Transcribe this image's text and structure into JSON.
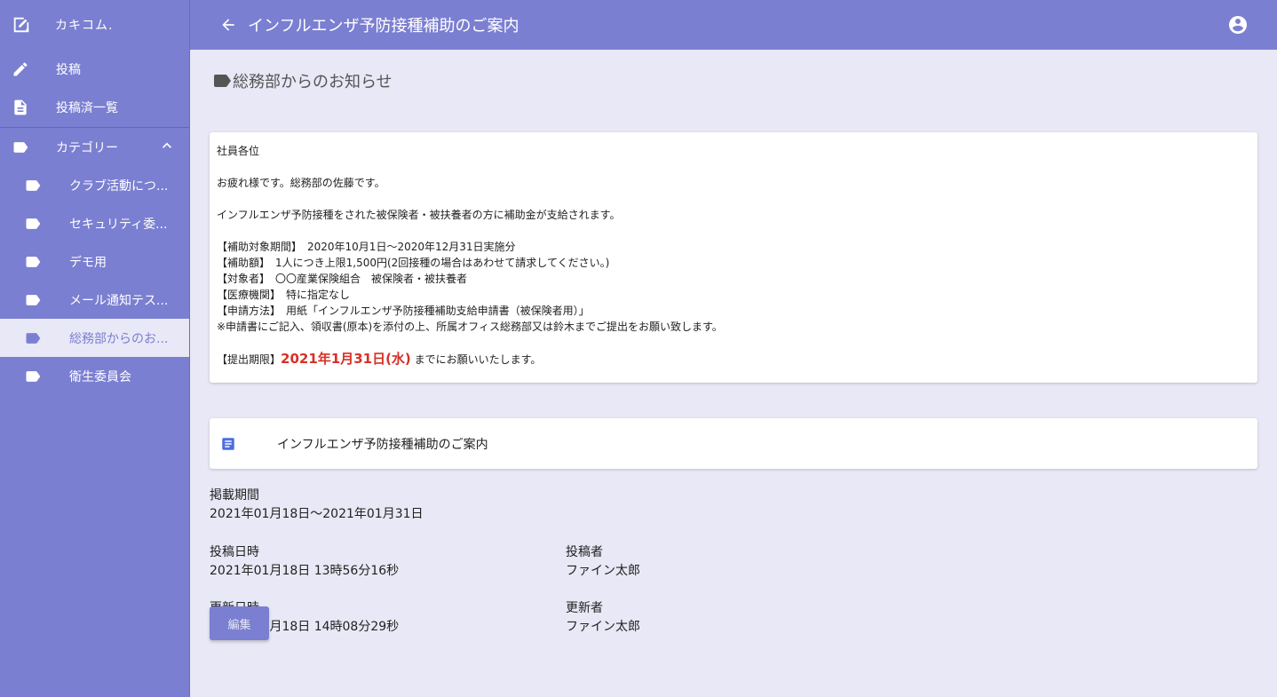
{
  "app": {
    "brand": "カキコム."
  },
  "header": {
    "title": "インフルエンザ予防接種補助のご案内"
  },
  "sidebar": {
    "items": [
      {
        "label": "投稿"
      },
      {
        "label": "投稿済一覧"
      },
      {
        "label": "カテゴリー"
      }
    ],
    "categories": [
      {
        "label": "クラブ活動につ..."
      },
      {
        "label": "セキュリティ委..."
      },
      {
        "label": "デモ用"
      },
      {
        "label": "メール通知テス..."
      },
      {
        "label": "総務部からのお..."
      },
      {
        "label": "衛生委員会"
      }
    ]
  },
  "main": {
    "category_heading": "総務部からのお知らせ",
    "body": {
      "l1": "社員各位",
      "l2": "お疲れ様です。総務部の佐藤です。",
      "l3": "インフルエンザ予防接種をされた被保険者・被扶養者の方に補助金が支給されます。",
      "l4": "【補助対象期間】　2020年10月1日〜2020年12月31日実施分",
      "l5": "【補助額】　1人につき上限1,500円(2回接種の場合はあわせて請求してください。)",
      "l6": "【対象者】　〇〇産業保険組合　被保険者・被扶養者",
      "l7": "【医療機関】　特に指定なし",
      "l8": "【申請方法】　用紙「インフルエンザ予防接種補助支給申請書（被保険者用）」",
      "l9": "※申請書にご記入、領収書(原本)を添付の上、所属オフィス総務部又は鈴木までご提出をお願い致します。",
      "deadline_prefix": "【提出期限】",
      "deadline": "2021年1月31日(水)",
      "deadline_suffix": " までにお願いいたします。"
    },
    "attachment": {
      "title": "インフルエンザ予防接種補助のご案内"
    },
    "meta": {
      "period_label": "掲載期間",
      "period_value": "2021年01月18日〜2021年01月31日",
      "posted_label": "投稿日時",
      "posted_value": "2021年01月18日 13時56分16秒",
      "poster_label": "投稿者",
      "poster_value": "ファイン太郎",
      "updated_label": "更新日時",
      "updated_value": "2021年01月18日 14時08分29秒",
      "updater_label": "更新者",
      "updater_value": "ファイン太郎"
    },
    "edit_label": "編集"
  },
  "colors": {
    "primary": "#7b7fd1",
    "background": "#e8e8f6",
    "deadline": "#d93025",
    "doc_icon": "#4a6ee0"
  }
}
